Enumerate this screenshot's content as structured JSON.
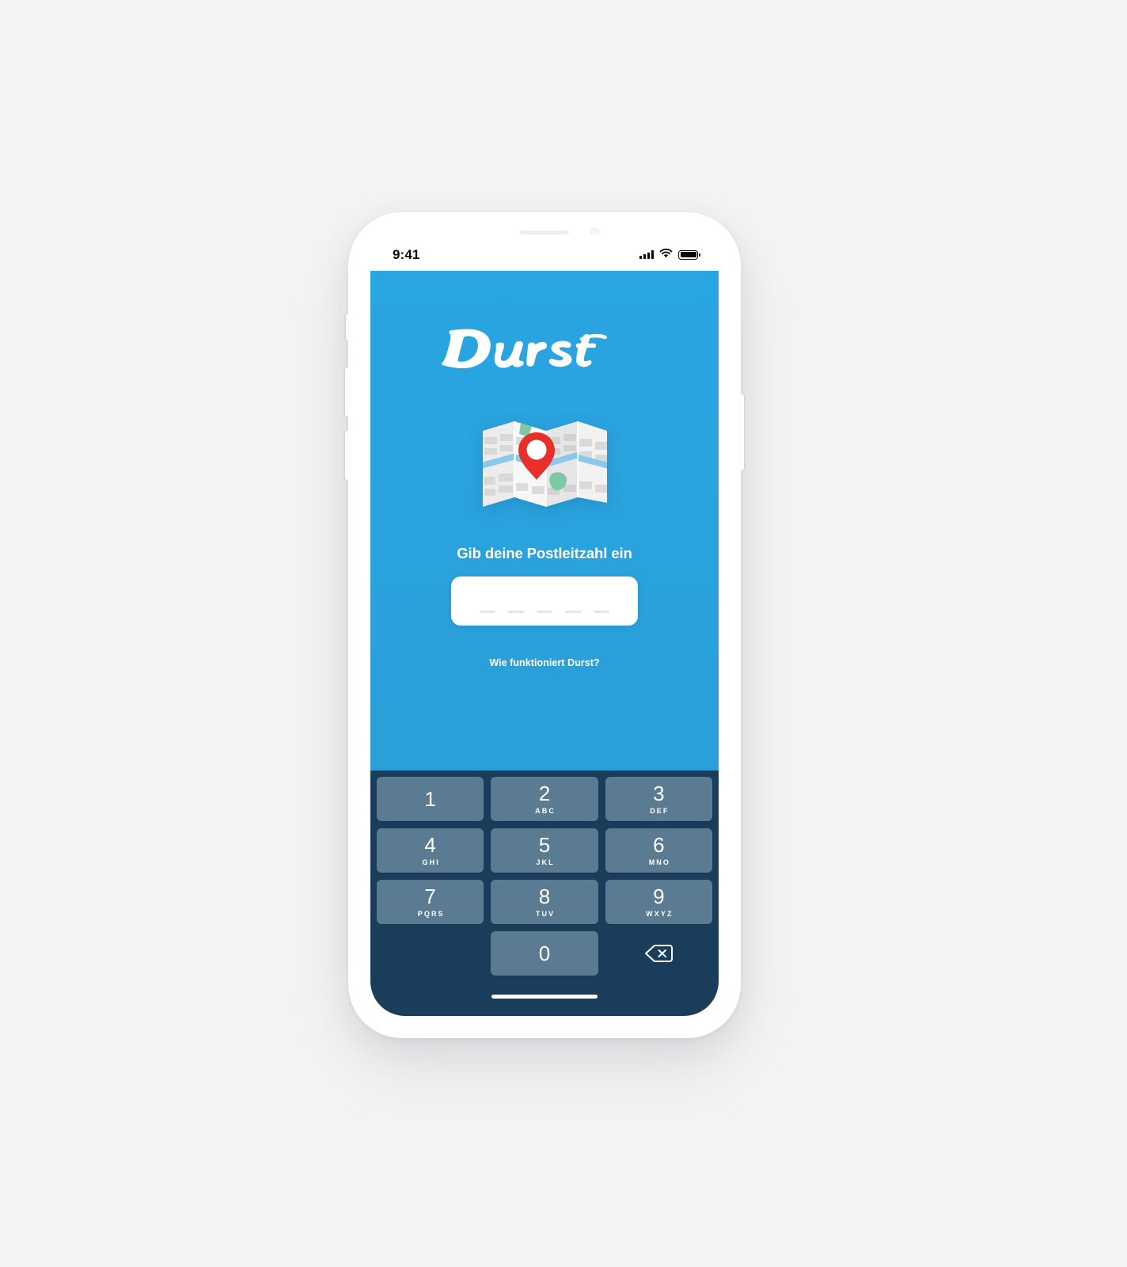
{
  "status_bar": {
    "time": "9:41",
    "icons": [
      "cellular-signal-icon",
      "wifi-icon",
      "battery-icon"
    ]
  },
  "app": {
    "brand": "Durst",
    "brand_color": "#2aa2dd",
    "accent_pin_color": "#e8302a",
    "keypad_key_color": "#5b7b93",
    "keypad_background_color": "#1b3d5c",
    "illustration": "folded-map-with-location-pin-icon",
    "prompt": "Gib deine Postleitzahl ein",
    "zip_input": {
      "value": "",
      "slots": 5,
      "placeholder": "_ _ _ _ _"
    },
    "howto_link": "Wie funktioniert Durst?"
  },
  "keypad": {
    "rows": [
      [
        {
          "digit": "1",
          "letters": ""
        },
        {
          "digit": "2",
          "letters": "ABC"
        },
        {
          "digit": "3",
          "letters": "DEF"
        }
      ],
      [
        {
          "digit": "4",
          "letters": "GHI"
        },
        {
          "digit": "5",
          "letters": "JKL"
        },
        {
          "digit": "6",
          "letters": "MNO"
        }
      ],
      [
        {
          "digit": "7",
          "letters": "PQRS"
        },
        {
          "digit": "8",
          "letters": "TUV"
        },
        {
          "digit": "9",
          "letters": "WXYZ"
        }
      ]
    ],
    "zero": {
      "digit": "0",
      "letters": ""
    },
    "backspace_icon": "backspace-delete-icon"
  }
}
